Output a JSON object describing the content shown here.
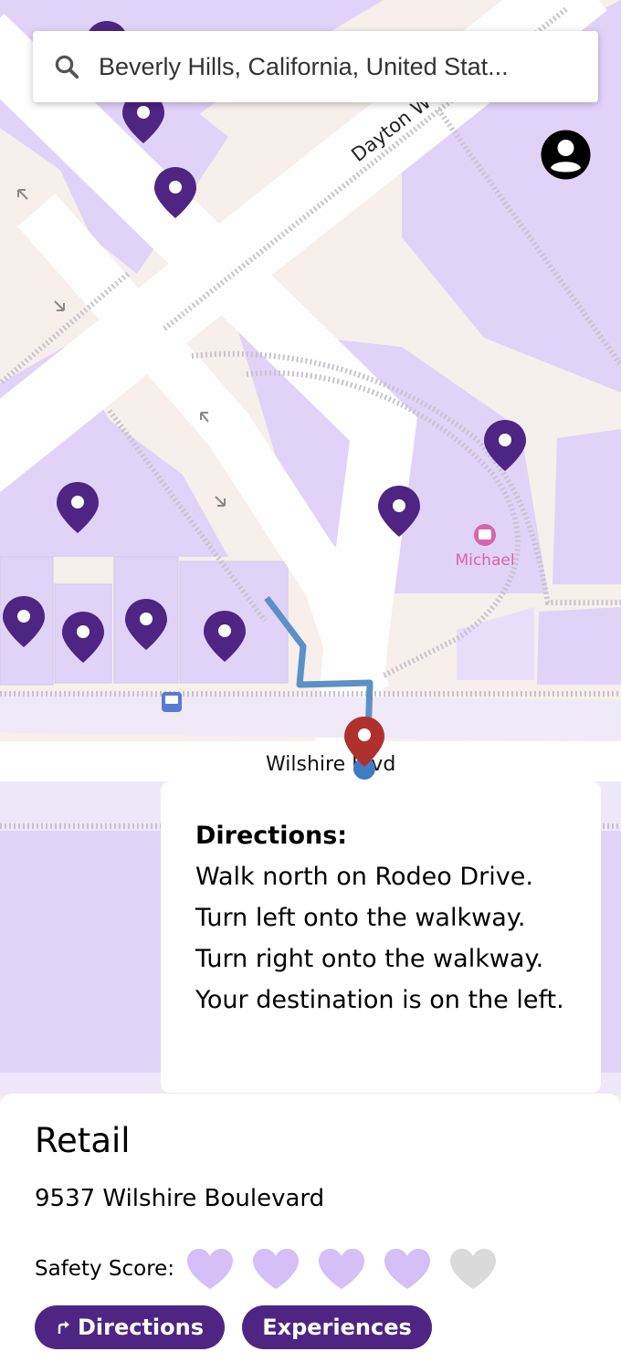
{
  "search": {
    "value": "Beverly Hills, California, United Stat..."
  },
  "map": {
    "street_labels": {
      "dayton": "Dayton W",
      "wilshire": "Wilshire Blvd"
    },
    "poi_label": "Michael",
    "colors": {
      "building": "#e1d3f8",
      "road": "#fefefe",
      "ground": "#f6efeb",
      "pin": "#4e2583",
      "route": "#5b91c4",
      "destination": "#b0302e"
    }
  },
  "directions": {
    "title": "Directions:",
    "steps": [
      "Walk north on Rodeo Drive.",
      "Turn left onto the walkway.",
      "Turn right onto the walkway.",
      "Your destination is on the left."
    ]
  },
  "place": {
    "type": "Retail",
    "address": "9537 Wilshire Boulevard",
    "safety_label": "Safety Score:",
    "safety_score": 4,
    "safety_max": 5,
    "heart_color_on": "#d4bff7",
    "heart_color_off": "#dadada"
  },
  "actions": {
    "directions_label": "Directions",
    "experiences_label": "Experiences",
    "accent": "#4e2583"
  }
}
